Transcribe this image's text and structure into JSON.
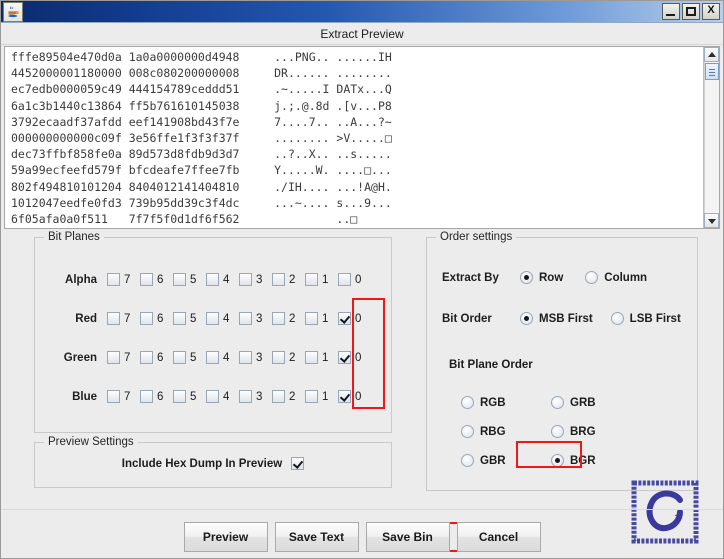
{
  "window": {
    "app_icon": "java-coffee-cup-icon",
    "controls": {
      "minimize": "_",
      "maximize": "□",
      "close": "X"
    }
  },
  "dialog": {
    "title": "Extract Preview"
  },
  "hex_dump": {
    "lines": [
      {
        "hex1": "fffe89504e470d0a",
        "hex2": "1a0a0000000d4948",
        "ascii1": "...PNG..",
        "ascii2": "......IH"
      },
      {
        "hex1": "4452000001180000",
        "hex2": "008c080200000008",
        "ascii1": "DR......",
        "ascii2": "........"
      },
      {
        "hex1": "ec7edb0000059c49",
        "hex2": "444154789ceddd51",
        "ascii1": ".~.....I",
        "ascii2": "DATx...Q"
      },
      {
        "hex1": "6a1c3b1440c13864",
        "hex2": "ff5b761610145038",
        "ascii1": "j.;.@.8d",
        "ascii2": ".[v...P8"
      },
      {
        "hex1": "3792ecaadf37afdd",
        "hex2": "eef141908bd43f7e",
        "ascii1": "7....7..",
        "ascii2": "..A...?~"
      },
      {
        "hex1": "000000000000c09f",
        "hex2": "3e56ffe1f3f3f37f",
        "ascii1": "........",
        "ascii2": ">V.....□"
      },
      {
        "hex1": "dec73ffbf858fe0a",
        "hex2": "89d573d8fdb9d3d7",
        "ascii1": "..?..X..",
        "ascii2": "..s....."
      },
      {
        "hex1": "59a99ecfeefd579f",
        "hex2": "bfcdeafe7ffee7fb",
        "ascii1": "Y.....W.",
        "ascii2": "....□..."
      },
      {
        "hex1": "802f494810101204",
        "hex2": "8404012141404810",
        "ascii1": "./IH....",
        "ascii2": "...!A@H."
      },
      {
        "hex1": "1012047eedfe0fd3",
        "hex2": "739b95dd39c3f4dc",
        "ascii1": "...~....",
        "ascii2": "s...9..."
      },
      {
        "hex1": "6f05afa0a0f511",
        "hex2": "7f7f5f0d1df6f562",
        "ascii1": "",
        "ascii2": "..□"
      }
    ],
    "scrollbar": {
      "up_arrow": "scroll-up-arrow-icon",
      "down_arrow": "scroll-down-arrow-icon"
    }
  },
  "bit_planes": {
    "legend": "Bit Planes",
    "bit_labels": [
      "7",
      "6",
      "5",
      "4",
      "3",
      "2",
      "1",
      "0"
    ],
    "rows": [
      {
        "label": "Alpha",
        "checked": [
          false,
          false,
          false,
          false,
          false,
          false,
          false,
          false
        ]
      },
      {
        "label": "Red",
        "checked": [
          false,
          false,
          false,
          false,
          false,
          false,
          false,
          true
        ]
      },
      {
        "label": "Green",
        "checked": [
          false,
          false,
          false,
          false,
          false,
          false,
          false,
          true
        ]
      },
      {
        "label": "Blue",
        "checked": [
          false,
          false,
          false,
          false,
          false,
          false,
          false,
          true
        ]
      }
    ],
    "highlight_color": "#f21616"
  },
  "order_settings": {
    "legend": "Order settings",
    "extract_by": {
      "label": "Extract By",
      "options": [
        "Row",
        "Column"
      ],
      "selected": "Row"
    },
    "bit_order": {
      "label": "Bit Order",
      "options": [
        "MSB First",
        "LSB First"
      ],
      "selected": "MSB First"
    },
    "bit_plane_order": {
      "label": "Bit Plane Order",
      "options": [
        "RGB",
        "GRB",
        "RBG",
        "BRG",
        "GBR",
        "BGR"
      ],
      "selected": "BGR"
    }
  },
  "preview_settings": {
    "legend": "Preview Settings",
    "include_hex_dump": {
      "label": "Include Hex Dump In Preview",
      "checked": true
    }
  },
  "buttons": {
    "preview": "Preview",
    "save_text": "Save Text",
    "save_bin": "Save Bin",
    "cancel": "Cancel"
  },
  "watermark": {
    "letter": "C",
    "color": "#3a3a9e"
  }
}
